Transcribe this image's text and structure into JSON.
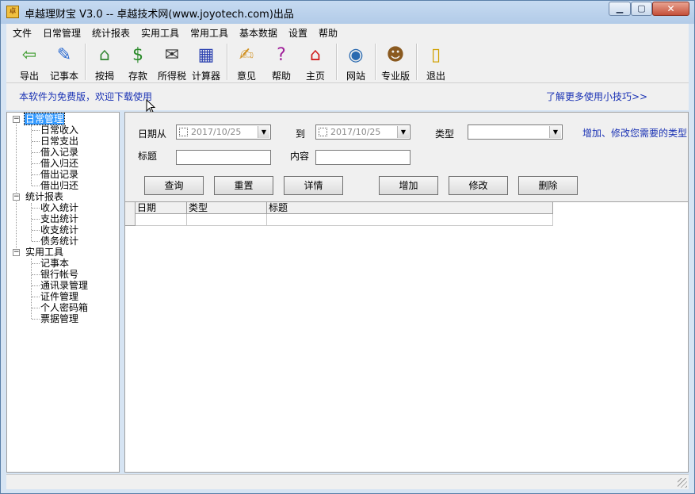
{
  "window": {
    "title": "卓越理财宝 V3.0 -- 卓越技术网(www.joyotech.com)出品",
    "app_icon_glyph": "卓"
  },
  "menu": [
    "文件",
    "日常管理",
    "统计报表",
    "实用工具",
    "常用工具",
    "基本数据",
    "设置",
    "帮助"
  ],
  "toolbar": [
    {
      "label": "导出",
      "icon": "export-icon",
      "glyph": "⇦",
      "color": "#3a9a2a"
    },
    {
      "label": "记事本",
      "icon": "notepad-icon",
      "glyph": "✎",
      "color": "#2a6ad0"
    },
    {
      "label": "按揭",
      "icon": "house-icon",
      "glyph": "⌂",
      "color": "#3a8a3a"
    },
    {
      "label": "存款",
      "icon": "money-icon",
      "glyph": "$",
      "color": "#2a8a2a"
    },
    {
      "label": "所得税",
      "icon": "tax-icon",
      "glyph": "✉",
      "color": "#333333"
    },
    {
      "label": "计算器",
      "icon": "calculator-icon",
      "glyph": "▦",
      "color": "#2a40b0"
    },
    {
      "label": "意见",
      "icon": "feedback-icon",
      "glyph": "✍",
      "color": "#d09020"
    },
    {
      "label": "帮助",
      "icon": "help-book-icon",
      "glyph": "?",
      "color": "#a0209a"
    },
    {
      "label": "主页",
      "icon": "home-icon",
      "glyph": "⌂",
      "color": "#d02020"
    },
    {
      "label": "网站",
      "icon": "globe-icon",
      "glyph": "◉",
      "color": "#2a6ab0"
    },
    {
      "label": "专业版",
      "icon": "user-icon",
      "glyph": "☻",
      "color": "#8a5a20"
    },
    {
      "label": "退出",
      "icon": "exit-door-icon",
      "glyph": "▯",
      "color": "#d0a000"
    }
  ],
  "notice": {
    "left": "本软件为免费版，欢迎下载使用",
    "right": "了解更多使用小技巧>>"
  },
  "tree": [
    {
      "label": "日常管理",
      "level": 0,
      "selected": true,
      "children": [
        "日常收入",
        "日常支出",
        "借入记录",
        "借入归还",
        "借出记录",
        "借出归还"
      ]
    },
    {
      "label": "统计报表",
      "level": 0,
      "selected": false,
      "children": [
        "收入统计",
        "支出统计",
        "收支统计",
        "债务统计"
      ]
    },
    {
      "label": "实用工具",
      "level": 0,
      "selected": false,
      "children": [
        "记事本",
        "银行帐号",
        "通讯录管理",
        "证件管理",
        "个人密码箱",
        "票据管理"
      ]
    }
  ],
  "filter": {
    "date_from_label": "日期从",
    "date_from_value": "2017/10/25",
    "date_to_label": "到",
    "date_to_value": "2017/10/25",
    "type_label": "类型",
    "type_value": "",
    "type_link": "增加、修改您需要的类型",
    "title_label": "标题",
    "title_value": "",
    "content_label": "内容",
    "content_value": ""
  },
  "buttons": {
    "query": "查询",
    "reset": "重置",
    "detail": "详情",
    "add": "增加",
    "edit": "修改",
    "delete": "删除"
  },
  "grid": {
    "columns": [
      "日期",
      "类型",
      "标题"
    ]
  }
}
